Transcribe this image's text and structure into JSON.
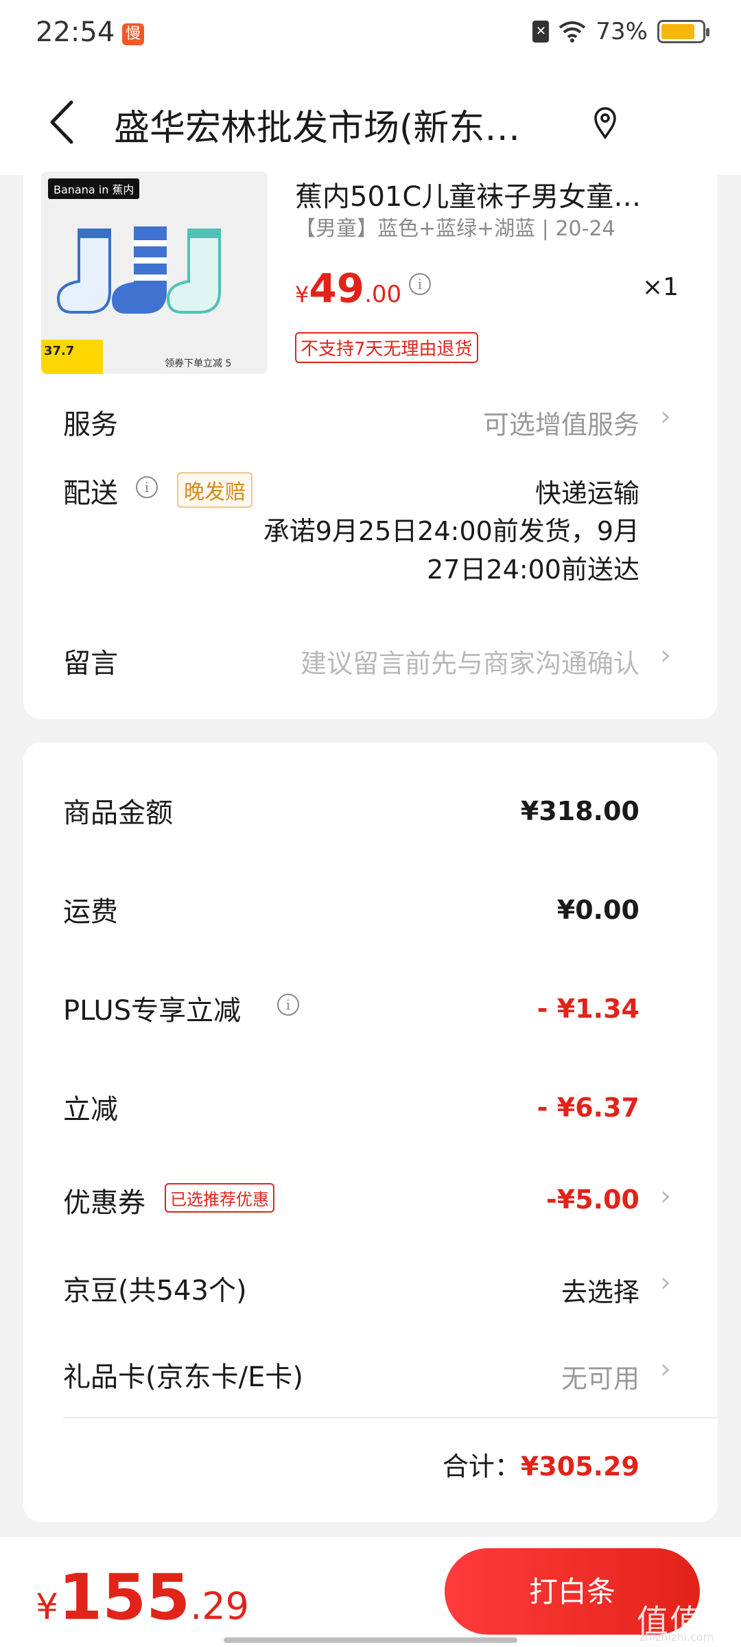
{
  "status_bar": {
    "time": "22:54",
    "app_badge": "慢",
    "battery": "73%"
  },
  "header": {
    "title": "盛华宏林批发市场(新东…"
  },
  "product": {
    "brand": "Banana in 蕉内",
    "thumb_price": "37.7",
    "thumb_promo": "领券下单立减 5",
    "name": "蕉内501C儿童袜子男女童…",
    "spec": "【男童】蓝色+蓝绿+湖蓝 | 20-24",
    "price_symbol": "¥",
    "price_int": "49",
    "price_dec": ".00",
    "quantity": "×1",
    "no_return": "不支持7天无理由退货"
  },
  "service": {
    "label": "服务",
    "value": "可选增值服务"
  },
  "delivery": {
    "label": "配送",
    "badge": "晚发赔",
    "method": "快递运输",
    "promise": "承诺9月25日24:00前发货，9月27日24:00前送达"
  },
  "message": {
    "label": "留言",
    "placeholder": "建议留言前先与商家沟通确认"
  },
  "summary": {
    "goods_label": "商品金额",
    "goods_value": "¥318.00",
    "shipping_label": "运费",
    "shipping_value": "¥0.00",
    "plus_label": "PLUS专享立减",
    "plus_value": "- ¥1.34",
    "discount_label": "立减",
    "discount_value": "- ¥6.37",
    "coupon_label": "优惠券",
    "coupon_badge": "已选推荐优惠",
    "coupon_value": "-¥5.00",
    "beans_label": "京豆(共543个)",
    "beans_value": "去选择",
    "giftcard_label": "礼品卡(京东卡/E卡)",
    "giftcard_value": "无可用",
    "total_label": "合计：",
    "total_value": "¥305.29"
  },
  "footer": {
    "final_symbol": "¥",
    "final_int": "155",
    "final_dec": ".29",
    "pay_button": "打白条",
    "watermark": "值值值",
    "watermark_sub": "zhizhizhi.com"
  }
}
